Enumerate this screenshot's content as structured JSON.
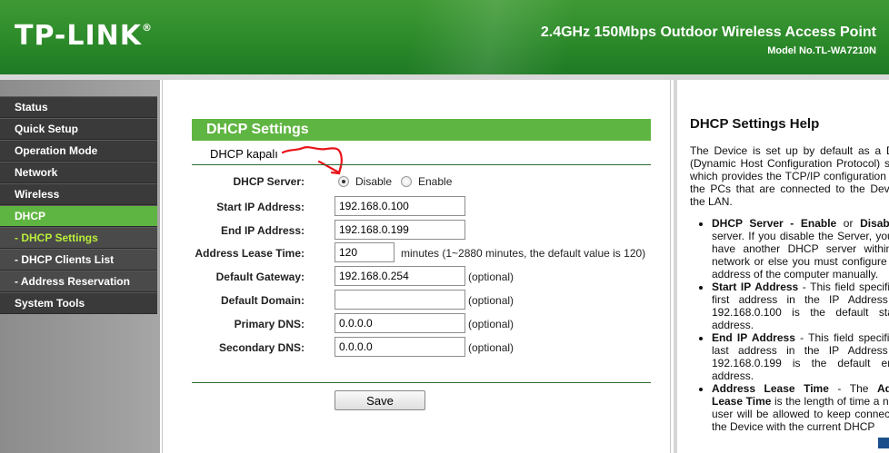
{
  "header": {
    "logo": "TP-LINK",
    "logo_reg": "®",
    "model_title": "2.4GHz 150Mbps Outdoor Wireless Access Point",
    "model_number": "Model No.TL-WA7210N"
  },
  "sidebar": {
    "items": [
      {
        "label": "Status"
      },
      {
        "label": "Quick Setup"
      },
      {
        "label": "Operation Mode"
      },
      {
        "label": "Network"
      },
      {
        "label": "Wireless"
      },
      {
        "label": "DHCP"
      },
      {
        "label": "- DHCP Settings"
      },
      {
        "label": "- DHCP Clients List"
      },
      {
        "label": "- Address Reservation"
      },
      {
        "label": "System Tools"
      }
    ]
  },
  "main": {
    "section_title": "DHCP Settings",
    "annotation": "DHCP kapalı",
    "dhcp_server": {
      "label": "DHCP Server:",
      "options": [
        "Disable",
        "Enable"
      ],
      "selected": "Disable"
    },
    "fields": [
      {
        "label": "Start IP Address:",
        "value": "192.168.0.100",
        "hint": ""
      },
      {
        "label": "End IP Address:",
        "value": "192.168.0.199",
        "hint": ""
      },
      {
        "label": "Address Lease Time:",
        "value": "120",
        "hint": "minutes (1~2880 minutes, the default value is 120)"
      },
      {
        "label": "Default Gateway:",
        "value": "192.168.0.254",
        "hint": "(optional)"
      },
      {
        "label": "Default Domain:",
        "value": "",
        "hint": "(optional)"
      },
      {
        "label": "Primary DNS:",
        "value": "0.0.0.0",
        "hint": "(optional)"
      },
      {
        "label": "Secondary DNS:",
        "value": "0.0.0.0",
        "hint": "(optional)"
      }
    ],
    "save_label": "Save"
  },
  "help": {
    "title": "DHCP Settings Help",
    "intro": "The Device is set up by default as a DHCP (Dynamic Host Configuration Protocol) server, which provides the TCP/IP configuration for all the PCs that are connected to the Device in the LAN.",
    "items": [
      {
        "term": "DHCP Server - Enable",
        "joiner": " or ",
        "term2": "Disable",
        "text": " the server. If you disable the Server, you must have another DHCP server within your network or else you must configure the IP address of the computer manually."
      },
      {
        "term": "Start IP Address",
        "joiner": "",
        "term2": "",
        "text": " - This field specifies the first address in the IP Address pool. 192.168.0.100 is the default start IP address."
      },
      {
        "term": "End IP Address",
        "joiner": "",
        "term2": "",
        "text": " - This field specifies the last address in the IP Address pool. 192.168.0.199 is the default end IP address."
      },
      {
        "term": "Address Lease Time",
        "joiner": " - The ",
        "term2": "Address Lease Time",
        "text": " is the length of time a network user will be allowed to keep connecting to the Device with the current DHCP"
      }
    ]
  },
  "colors": {
    "brand_green": "#5fb541",
    "header_green": "#2c8a2a",
    "current_item_text": "#b8ee3a",
    "annotation_red": "#e8151b"
  }
}
